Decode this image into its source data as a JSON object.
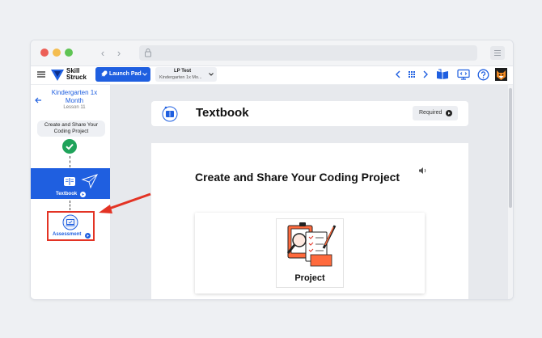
{
  "browser": {
    "buttons": [
      "back-icon",
      "forward-icon",
      "lock-icon",
      "browser-menu-icon"
    ]
  },
  "topbar": {
    "brand_line1": "Skill",
    "brand_line2": "Struck",
    "launch_pad_label": "Launch Pad",
    "lp_title": "LP Test",
    "lp_subtitle": "Kindergarten 1x Mo..."
  },
  "sidebar": {
    "course_title": "Kindergarten 1x Month",
    "lesson": "Lesson 11",
    "project_title": "Create and Share Your Coding Project",
    "items": [
      {
        "label": "Textbook",
        "active": true
      },
      {
        "label": "Assessment",
        "active": false
      }
    ]
  },
  "main": {
    "header_title": "Textbook",
    "required_label": "Required",
    "content_title": "Create and Share Your Coding Project",
    "image_caption": "Project"
  },
  "colors": {
    "accent": "#1f5fe0",
    "highlight": "#e33324",
    "success": "#1fa35a"
  }
}
